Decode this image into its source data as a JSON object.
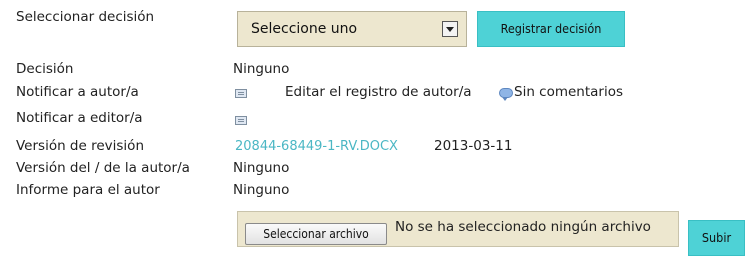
{
  "decision_row": {
    "label": "Seleccionar decisión",
    "select_value": "Seleccione uno",
    "submit_label": "Registrar decisión"
  },
  "rows": [
    {
      "label": "Decisión",
      "value": "Ninguno"
    },
    {
      "label": "Notificar a autor/a",
      "edit_text": "Editar el registro de autor/a",
      "comments_text": "Sin comentarios"
    },
    {
      "label": "Notificar a editor/a"
    },
    {
      "label": "Versión de revisión",
      "file_link": "20844-68449-1-RV.DOCX",
      "date": "2013-03-11"
    },
    {
      "label": "Versión del / de la autor/a",
      "value": "Ninguno"
    },
    {
      "label": "Informe para el autor",
      "value": "Ninguno"
    }
  ],
  "upload": {
    "browse_label": "Seleccionar archivo",
    "status_text": "No se ha seleccionado ningún archivo",
    "submit_label": "Subir"
  },
  "colors": {
    "accent": "#4ed2d6",
    "link": "#4bb7c4",
    "field_background": "#ede7cf"
  },
  "icons": {
    "notify": "mail-icon",
    "comments": "comment-bubble-icon"
  }
}
